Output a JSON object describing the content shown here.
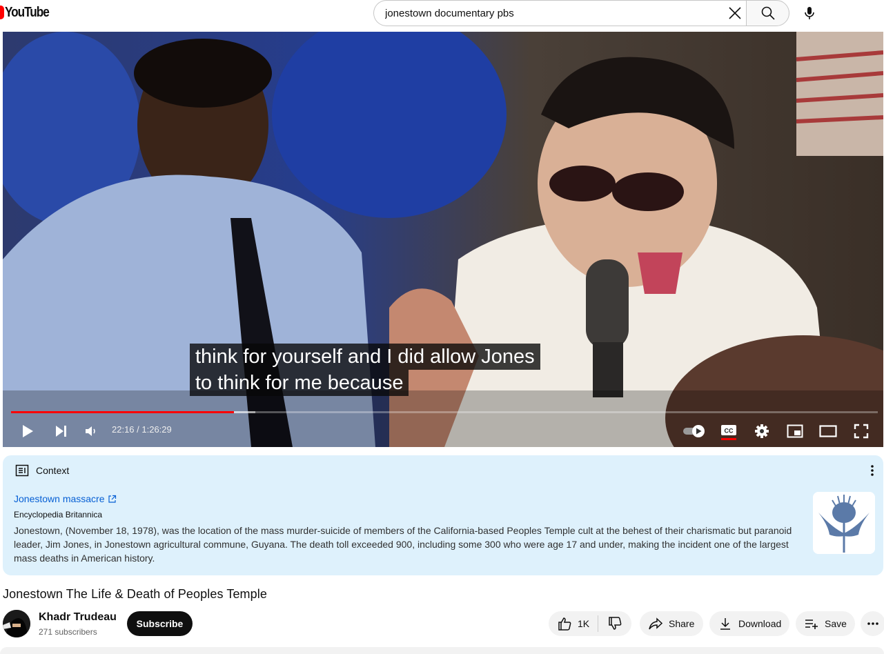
{
  "header": {
    "logo_text": "YouTube",
    "search": {
      "value": "jonestown documentary pbs",
      "placeholder": "Search"
    },
    "icons": [
      "youtube-logo",
      "clear-icon",
      "search-icon",
      "mic-icon"
    ]
  },
  "player": {
    "captions": [
      "think for yourself and I did allow Jones",
      "to think for me because"
    ],
    "time": "22:16 / 1:26:29",
    "progress": {
      "played_fraction": 0.257,
      "buffered_fraction": 0.282
    },
    "autoplay": "on",
    "captions_enabled": true,
    "icons": [
      "play-icon",
      "next-icon",
      "volume-icon",
      "autoplay-toggle",
      "cc-icon",
      "settings-icon",
      "miniplayer-icon",
      "theater-icon",
      "fullscreen-icon"
    ]
  },
  "context": {
    "heading": "Context",
    "link_text": "Jonestown massacre",
    "source": "Encyclopedia Britannica",
    "body": "Jonestown, (November 18, 1978), was the location of the mass murder-suicide of members of the California-based Peoples Temple cult at the behest of their charismatic but paranoid leader, Jim Jones, in Jonestown agricultural commune, Guyana. The death toll exceeded 900, including some 300 who were age 17 and under, making the incident one of the largest mass deaths in American history."
  },
  "video": {
    "title": "Jonestown The Life & Death of Peoples Temple",
    "channel": "Khadr Trudeau",
    "subscribers": "271 subscribers",
    "subscribe_label": "Subscribe",
    "likes": "1K",
    "share_label": "Share",
    "download_label": "Download",
    "save_label": "Save"
  },
  "colors": {
    "brand_red": "#ff0000",
    "context_bg": "#def1fc",
    "link_blue": "#065fd4",
    "subscribe_bg": "#0f0f0f",
    "pill_bg": "#f2f2f2"
  }
}
